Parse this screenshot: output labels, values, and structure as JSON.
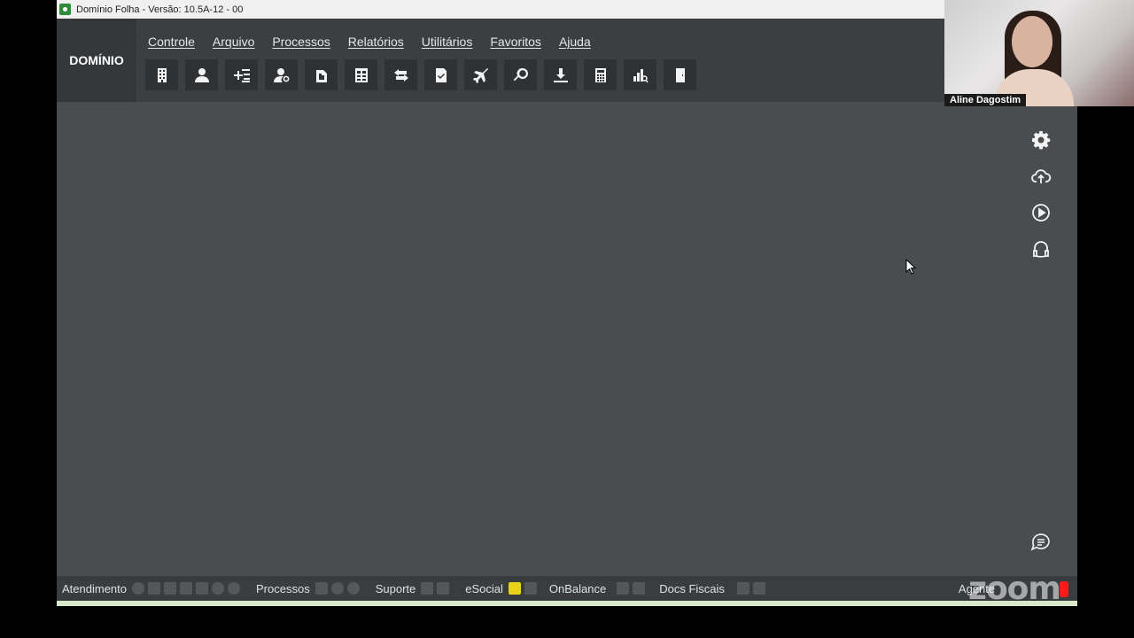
{
  "window": {
    "title": "Domínio Folha - Versão: 10.5A-12 - 00"
  },
  "brand": "DOMÍNIO",
  "menu": [
    "Controle",
    "Arquivo",
    "Processos",
    "Relatórios",
    "Utilitários",
    "Favoritos",
    "Ajuda"
  ],
  "toolbar": [
    "building-icon",
    "person-icon",
    "add-list-icon",
    "person-search-icon",
    "document-fold-icon",
    "calculator-sheet-icon",
    "transfer-icon",
    "document-check-icon",
    "airplane-icon",
    "search-icon",
    "download-icon",
    "calculator-icon",
    "report-chart-icon",
    "door-exit-icon"
  ],
  "right_panel": [
    "gear-icon",
    "cloud-upload-icon",
    "play-icon",
    "headset-icon"
  ],
  "status_bar": {
    "sections": [
      "Atendimento",
      "Processos",
      "Suporte",
      "eSocial",
      "OnBalance",
      "Docs Fiscais",
      "Agente"
    ]
  },
  "video": {
    "participant_name": "Aline Dagostim",
    "watermark": "zoom"
  },
  "colors": {
    "app_bg": "#4a4d50",
    "header_bg": "#3c3f42",
    "accent_yellow": "#e8d21a",
    "rec_red": "#ff1a1a"
  }
}
